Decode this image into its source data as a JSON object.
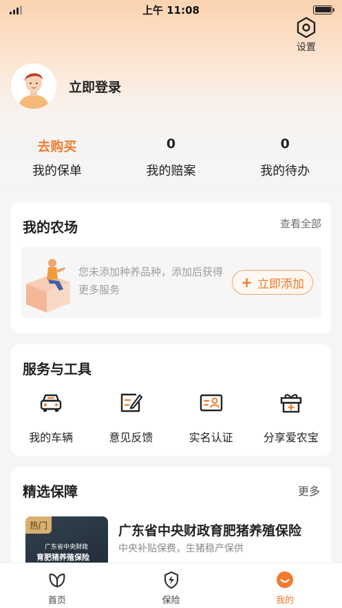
{
  "status_bar": {
    "time": "上午 11:08"
  },
  "header": {
    "settings_label": "设置"
  },
  "profile": {
    "login_label": "立即登录"
  },
  "stats": [
    {
      "value": "去购买",
      "label": "我的保单"
    },
    {
      "value": "0",
      "label": "我的赔案"
    },
    {
      "value": "0",
      "label": "我的待办"
    }
  ],
  "farm": {
    "title": "我的农场",
    "view_all": "查看全部",
    "empty_text": "您未添加种养品种，添加后获得更多服务",
    "add_button": "立即添加"
  },
  "services": {
    "title": "服务与工具",
    "items": [
      {
        "label": "我的车辆",
        "icon": "car-icon"
      },
      {
        "label": "意见反馈",
        "icon": "feedback-icon"
      },
      {
        "label": "实名认证",
        "icon": "id-card-icon"
      },
      {
        "label": "分享爱农宝",
        "icon": "gift-icon"
      }
    ]
  },
  "picks": {
    "title": "精选保障",
    "more": "更多",
    "product": {
      "tag": "热门",
      "thumb_line1": "广东省中央财政",
      "thumb_line2": "育肥猪养殖保险",
      "title": "广东省中央财政育肥猪养殖保险",
      "desc": "中央补贴保费，生猪稳产保供"
    }
  },
  "tabbar": {
    "items": [
      {
        "label": "首页",
        "icon": "leaf-icon"
      },
      {
        "label": "保险",
        "icon": "shield-bolt-icon"
      },
      {
        "label": "我的",
        "icon": "smile-icon"
      }
    ],
    "active_index": 2,
    "accent": "#ef7a2a"
  }
}
